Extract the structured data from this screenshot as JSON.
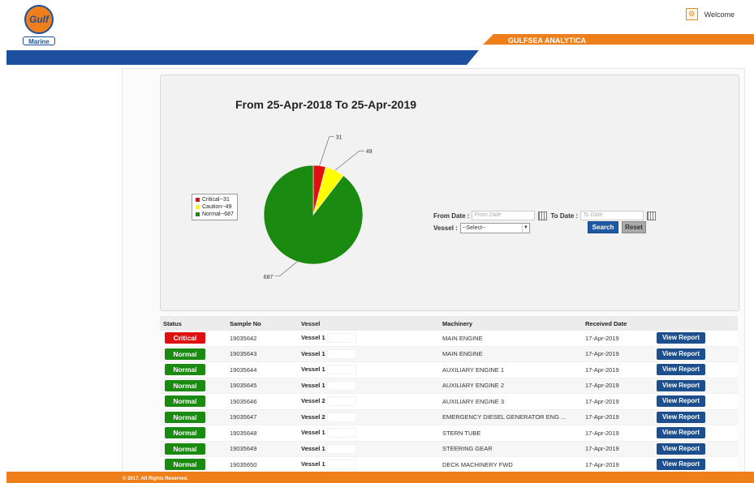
{
  "header": {
    "logo_text": "Gulf",
    "logo_sub": "Marine",
    "brand": "GULFSEA ANALYTICA",
    "welcome": "Welcome",
    "colors": {
      "orange": "#ef7f1a",
      "blue": "#1d4f9f"
    }
  },
  "chart_data": {
    "type": "pie",
    "title": "From 25-Apr-2018 To 25-Apr-2019",
    "slices": [
      {
        "name": "Critical--31",
        "value": 31,
        "label": "31",
        "color": "#e01010"
      },
      {
        "name": "Caution--49",
        "value": 49,
        "label": "49",
        "color": "#ffff00"
      },
      {
        "name": "Normal--687",
        "value": 687,
        "label": "687",
        "color": "#1a8a10"
      }
    ],
    "legend_position": "left"
  },
  "filters": {
    "from_label": "From Date :",
    "from_placeholder": "From Date",
    "to_label": "To Date :",
    "to_placeholder": "To Date",
    "vessel_label": "Vessel :",
    "vessel_selected": "--Select--",
    "search_label": "Search",
    "reset_label": "Reset"
  },
  "table": {
    "columns": [
      "Status",
      "Sample No",
      "Vessel",
      "Machinery",
      "Received Date",
      ""
    ],
    "action_label": "View Report",
    "status_colors": {
      "Critical": "#e01010",
      "Normal": "#1a8a10"
    },
    "rows": [
      {
        "status": "Critical",
        "sample": "19035642",
        "vessel": "Vessel 1",
        "machinery": "MAIN ENGINE",
        "date": "17-Apr-2019"
      },
      {
        "status": "Normal",
        "sample": "19035643",
        "vessel": "Vessel 1",
        "machinery": "MAIN ENGINE",
        "date": "17-Apr-2019"
      },
      {
        "status": "Normal",
        "sample": "19035644",
        "vessel": "Vessel 1",
        "machinery": "AUXILIARY ENGINE 1",
        "date": "17-Apr-2019"
      },
      {
        "status": "Normal",
        "sample": "19035645",
        "vessel": "Vessel 1",
        "machinery": "AUXILIARY ENGINE 2",
        "date": "17-Apr-2019"
      },
      {
        "status": "Normal",
        "sample": "19035646",
        "vessel": "Vessel 2",
        "machinery": "AUXILIARY ENGINE 3",
        "date": "17-Apr-2019"
      },
      {
        "status": "Normal",
        "sample": "19035647",
        "vessel": "Vessel 2",
        "machinery": "EMERGENCY DIESEL GENERATOR ENG ...",
        "date": "17-Apr-2019"
      },
      {
        "status": "Normal",
        "sample": "19035648",
        "vessel": "Vessel 1",
        "machinery": "STERN TUBE",
        "date": "17-Apr-2019"
      },
      {
        "status": "Normal",
        "sample": "19035649",
        "vessel": "Vessel 1",
        "machinery": "STEERING GEAR",
        "date": "17-Apr-2019"
      },
      {
        "status": "Normal",
        "sample": "19035650",
        "vessel": "Vessel 1",
        "machinery": "DECK MACHINERY FWD",
        "date": "17-Apr-2019"
      }
    ]
  },
  "footer": {
    "text": "© 2017. All Rights Reserved."
  }
}
